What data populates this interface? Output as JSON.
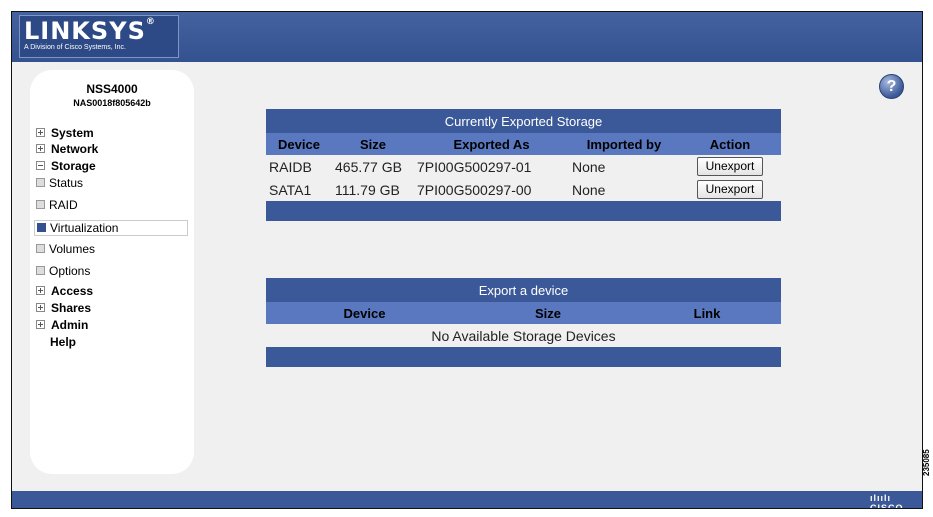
{
  "brand": {
    "logo_text": "LINKSYS",
    "logo_mark": "®",
    "tagline": "A Division of Cisco Systems, Inc."
  },
  "device": {
    "model": "NSS4000",
    "serial": "NAS0018f805642b"
  },
  "nav": {
    "system": "System",
    "network": "Network",
    "storage": "Storage",
    "status": "Status",
    "raid": "RAID",
    "virtualization": "Virtualization",
    "volumes": "Volumes",
    "options": "Options",
    "access": "Access",
    "shares": "Shares",
    "admin": "Admin",
    "help": "Help"
  },
  "help_button": "?",
  "exported": {
    "title": "Currently Exported Storage",
    "headers": [
      "Device",
      "Size",
      "Exported As",
      "Imported by",
      "Action"
    ],
    "rows": [
      {
        "device": "RAIDB",
        "size": "465.77 GB",
        "exported_as": "7PI00G500297-01",
        "imported_by": "None",
        "action": "Unexport"
      },
      {
        "device": "SATA1",
        "size": "111.79 GB",
        "exported_as": "7PI00G500297-00",
        "imported_by": "None",
        "action": "Unexport"
      }
    ]
  },
  "export": {
    "title": "Export a device",
    "headers": [
      "Device",
      "Size",
      "Link"
    ],
    "empty": "No Available Storage Devices"
  },
  "footer": {
    "cisco": "ılıılı CISCO"
  },
  "figure_id": "235085",
  "colors": {
    "bar": "#3b5998",
    "header": "#5a78c0",
    "background": "#f0f0f0"
  }
}
